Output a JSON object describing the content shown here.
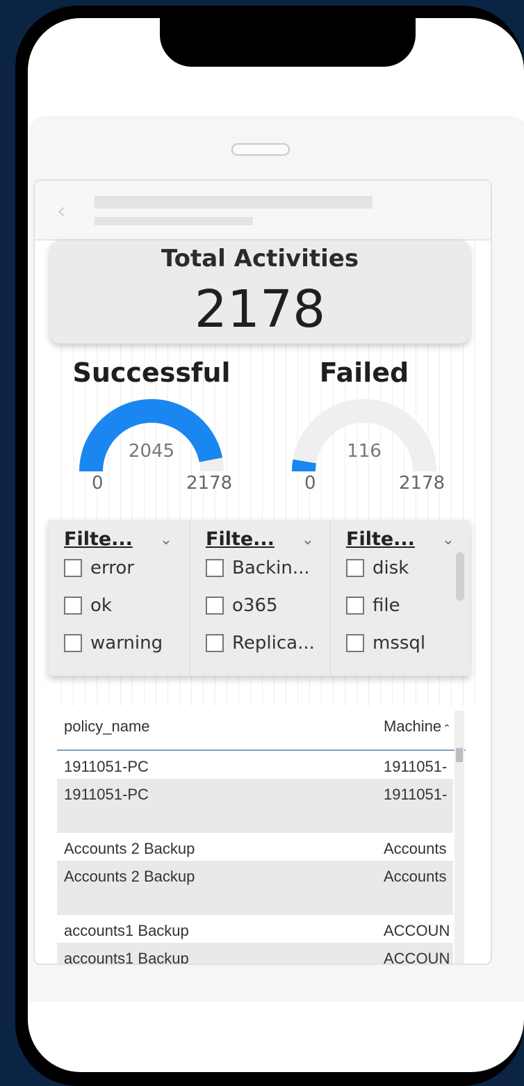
{
  "kpi": {
    "title": "Total Activities",
    "value": "2178"
  },
  "gauges": [
    {
      "title": "Successful",
      "value": "2045",
      "min": "0",
      "max": "2178",
      "fill": 0.939,
      "color": "#1a86f0"
    },
    {
      "title": "Failed",
      "value": "116",
      "min": "0",
      "max": "2178",
      "fill": 0.053,
      "color": "#1a86f0"
    }
  ],
  "slicers": [
    {
      "header": "Filte...",
      "items": [
        "error",
        "ok",
        "warning"
      ]
    },
    {
      "header": "Filte...",
      "items": [
        "Backin...",
        "o365",
        "Replica..."
      ]
    },
    {
      "header": "Filte...",
      "items": [
        "disk",
        "file",
        "mssql"
      ]
    }
  ],
  "table": {
    "columns": [
      "policy_name",
      "Machine"
    ],
    "rows": [
      [
        "1911051-PC",
        "1911051-"
      ],
      [
        "1911051-PC",
        "1911051-"
      ],
      [
        "Accounts 2 Backup",
        "Accounts"
      ],
      [
        "Accounts 2 Backup",
        "Accounts"
      ],
      [
        "accounts1 Backup",
        "ACCOUN"
      ],
      [
        "accounts1 Backup",
        "ACCOUN"
      ]
    ]
  },
  "colors": {
    "accent": "#1a86f0",
    "track": "#efefef",
    "background": "#0b2444"
  },
  "icons": {
    "back": "chevron-left-icon",
    "dropdown": "chevron-down-icon",
    "sort": "sort-ascending-icon"
  }
}
